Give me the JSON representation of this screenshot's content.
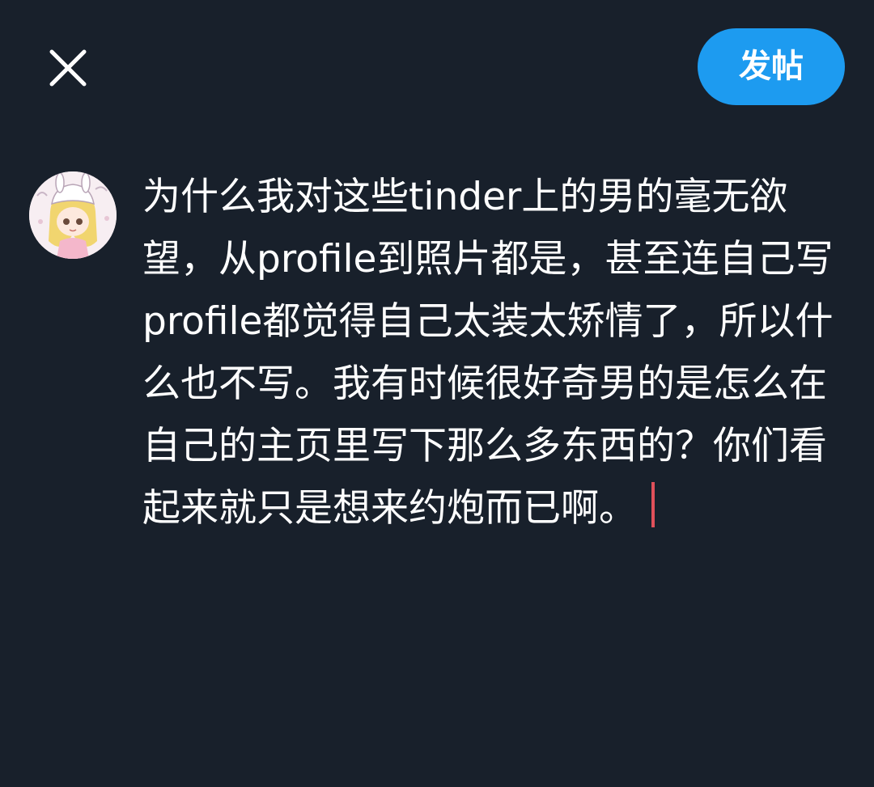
{
  "header": {
    "close_icon": "close-icon",
    "post_label": "发帖"
  },
  "avatar": {
    "icon": "user-avatar"
  },
  "compose": {
    "text": "为什么我对这些tinder上的男的毫无欲望，从profile到照片都是，甚至连自己写profile都觉得自己太装太矫情了，所以什么也不写。我有时候很好奇男的是怎么在自己的主页里写下那么多东西的？你们看起来就只是想来约炮而已啊。"
  },
  "colors": {
    "background": "#18202b",
    "accent": "#1d9bf0",
    "caret": "#e0505a",
    "text": "#ffffff"
  }
}
